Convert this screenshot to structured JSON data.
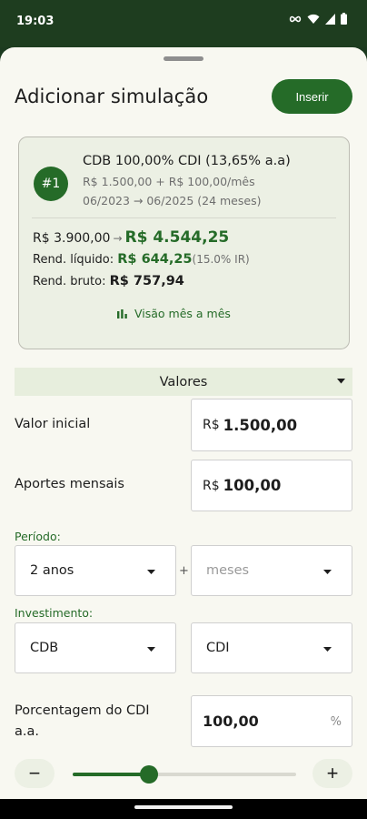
{
  "status_bar": {
    "time": "19:03"
  },
  "header": {
    "title": "Adicionar simulação",
    "insert_label": "Inserir"
  },
  "card": {
    "badge": "#1",
    "title": "CDB 100,00% CDI (13,65% a.a)",
    "subtitle_contrib": "R$ 1.500,00 + R$ 100,00/mês",
    "subtitle_period": "06/2023 → 06/2025 (24 meses)",
    "initial_value": "R$ 3.900,00",
    "arrow": "→",
    "final_value": "R$ 4.544,25",
    "net_label": "Rend. líquido:",
    "net_value": "R$ 644,25",
    "net_ir": "(15.0% IR)",
    "gross_label": "Rend. bruto:",
    "gross_value": "R$ 757,94",
    "month_view_label": "Visão mês a mês"
  },
  "values_section": {
    "label": "Valores"
  },
  "initial": {
    "label": "Valor inicial",
    "currency": "R$",
    "value": "1.500,00"
  },
  "monthly": {
    "label": "Aportes mensais",
    "currency": "R$",
    "value": "100,00"
  },
  "period": {
    "label": "Período:",
    "years_value": "2 anos",
    "plus": "+",
    "months_placeholder": "meses"
  },
  "investment": {
    "label": "Investimento:",
    "type_value": "CDB",
    "index_value": "CDI"
  },
  "percentage": {
    "label": "Porcentagem do CDI a.a.",
    "value": "100,00",
    "unit": "%"
  },
  "slider": {
    "minus": "−",
    "plus": "+",
    "level": 0.34
  },
  "colors": {
    "accent": "#256b28",
    "status_bar": "#1e3d1f",
    "sheet": "#f8f8f1"
  }
}
